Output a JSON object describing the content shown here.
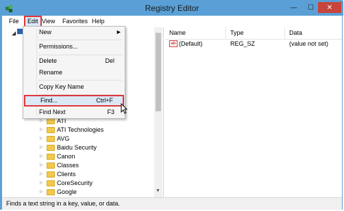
{
  "window": {
    "title": "Registry Editor",
    "minimize": "—",
    "maximize": "☐",
    "close": "✕"
  },
  "menubar": {
    "file": "File",
    "edit": "Edit",
    "view": "View",
    "favorites": "Favorites",
    "help": "Help"
  },
  "edit_menu": {
    "new": "New",
    "permissions": "Permissions...",
    "delete": "Delete",
    "delete_shortcut": "Del",
    "rename": "Rename",
    "copy_key_name": "Copy Key Name",
    "find": "Find...",
    "find_shortcut": "Ctrl+F",
    "find_next": "Find Next",
    "find_next_shortcut": "F3"
  },
  "tree": {
    "items": [
      "ATI",
      "ATI Technologies",
      "AVG",
      "Baidu Security",
      "Canon",
      "Classes",
      "Clients",
      "CoreSecurity",
      "Google"
    ]
  },
  "list": {
    "headers": {
      "name": "Name",
      "type": "Type",
      "data": "Data"
    },
    "rows": [
      {
        "icon": "ab",
        "name": "(Default)",
        "type": "REG_SZ",
        "data": "(value not set)"
      }
    ]
  },
  "status": "Finds a text string in a key, value, or data.",
  "colors": {
    "titlebar": "#5aa0d6",
    "highlight_border": "#e0343a",
    "close_button": "#c7453b"
  }
}
